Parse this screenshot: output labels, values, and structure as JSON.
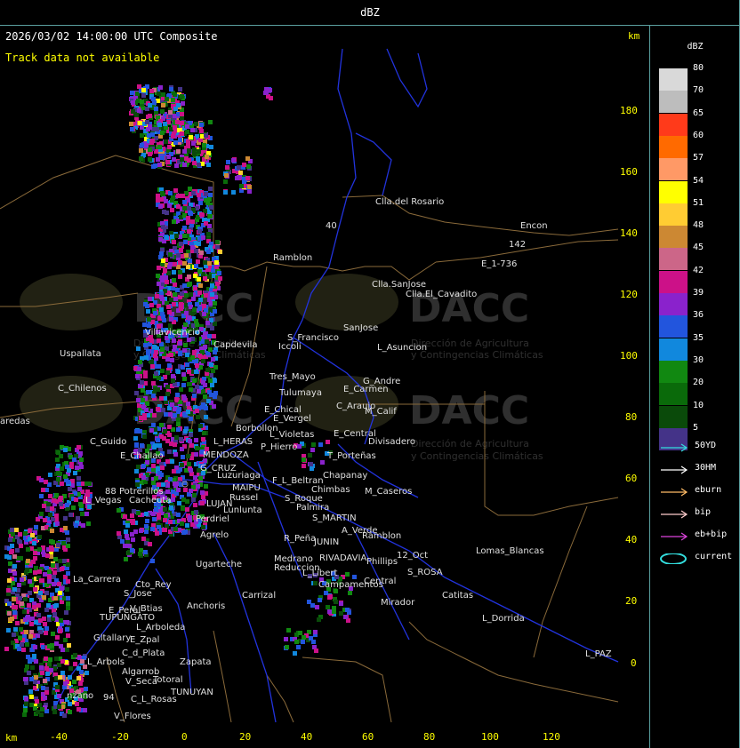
{
  "title": "dBZ",
  "timestamp": "2026/03/02 14:00:00 UTC Composite",
  "track_status": "Track data not available",
  "axis_unit": "km",
  "x_ticks": [
    "-40",
    "-20",
    "0",
    "20",
    "40",
    "60",
    "80",
    "100",
    "120"
  ],
  "y_ticks": [
    "180",
    "160",
    "140",
    "120",
    "100",
    "80",
    "60",
    "40",
    "20",
    "0"
  ],
  "watermark": {
    "brand": "DACC",
    "line1": "Dirección de Agricultura",
    "line2": "y Contingencias Climáticas"
  },
  "legend": {
    "title": "dBZ",
    "levels": [
      {
        "value": "80",
        "color": "#d9d9d9"
      },
      {
        "value": "70",
        "color": "#bdbdbd"
      },
      {
        "value": "65",
        "color": "#ff3a1a"
      },
      {
        "value": "60",
        "color": "#ff6a00"
      },
      {
        "value": "57",
        "color": "#ff9966"
      },
      {
        "value": "54",
        "color": "#ffff00"
      },
      {
        "value": "51",
        "color": "#ffcc33"
      },
      {
        "value": "48",
        "color": "#cc8833"
      },
      {
        "value": "45",
        "color": "#cc6688"
      },
      {
        "value": "42",
        "color": "#cc1188"
      },
      {
        "value": "39",
        "color": "#8a22cc"
      },
      {
        "value": "36",
        "color": "#2255dd"
      },
      {
        "value": "35",
        "color": "#1188dd"
      },
      {
        "value": "30",
        "color": "#118811"
      },
      {
        "value": "20",
        "color": "#0a6a0a"
      },
      {
        "value": "10",
        "color": "#0a4a0a"
      },
      {
        "value": "5",
        "color": "#443388"
      }
    ],
    "tracks": [
      {
        "label": "50YD",
        "color": "#33dddd"
      },
      {
        "label": "30HM",
        "color": "#ffffff"
      },
      {
        "label": "eburn",
        "color": "#ffbb66"
      },
      {
        "label": "bip",
        "color": "#ffcccc"
      },
      {
        "label": "eb+bip",
        "color": "#dd44dd"
      },
      {
        "label": "current",
        "color": "#33dddd"
      }
    ]
  },
  "places": [
    {
      "name": "Clla.del Rosario"
    },
    {
      "name": "Encon"
    },
    {
      "name": "142"
    },
    {
      "name": "E_1-736"
    },
    {
      "name": "Ramblon"
    },
    {
      "name": "40"
    },
    {
      "name": "Clla.SanJose"
    },
    {
      "name": "Clla.El_Cavadito"
    },
    {
      "name": "Villavicencio"
    },
    {
      "name": "Capdevila"
    },
    {
      "name": "S_Francisco"
    },
    {
      "name": "SanJose"
    },
    {
      "name": "Iccoli"
    },
    {
      "name": "L_Asuncion"
    },
    {
      "name": "Uspallata"
    },
    {
      "name": "Tres_Mayo"
    },
    {
      "name": "G_Andre"
    },
    {
      "name": "E_Carmen"
    },
    {
      "name": "C_Chilenos"
    },
    {
      "name": "Tulumaya"
    },
    {
      "name": "C_Araujo"
    },
    {
      "name": "E_Chical"
    },
    {
      "name": "M_Calif"
    },
    {
      "name": "E_Vergel"
    },
    {
      "name": "aredas"
    },
    {
      "name": "Borbollon"
    },
    {
      "name": "L_Violetas"
    },
    {
      "name": "E_Central"
    },
    {
      "name": "Divisadero"
    },
    {
      "name": "C_Guido"
    },
    {
      "name": "L_HERAS"
    },
    {
      "name": "P_Hierro"
    },
    {
      "name": "E_Challao"
    },
    {
      "name": "MENDOZA"
    },
    {
      "name": "T_Porteñas"
    },
    {
      "name": "G_CRUZ"
    },
    {
      "name": "Luzuriaga"
    },
    {
      "name": "F_L_Beltran"
    },
    {
      "name": "Chapanay"
    },
    {
      "name": "88"
    },
    {
      "name": "Potrerillos"
    },
    {
      "name": "MAIPU"
    },
    {
      "name": "Chimbas"
    },
    {
      "name": "M_Caseros"
    },
    {
      "name": "L_Vegas"
    },
    {
      "name": "Cacheuta"
    },
    {
      "name": "Russel"
    },
    {
      "name": "S_Roque"
    },
    {
      "name": "LUJAN"
    },
    {
      "name": "Palmira"
    },
    {
      "name": "Lunlunta"
    },
    {
      "name": "S_MARTIN"
    },
    {
      "name": "Perdriel"
    },
    {
      "name": "A_Verde"
    },
    {
      "name": "Agrelo"
    },
    {
      "name": "Ramblon"
    },
    {
      "name": "R_Peña"
    },
    {
      "name": "JUNIN"
    },
    {
      "name": "Lomas_Blancas"
    },
    {
      "name": "Ugarteche"
    },
    {
      "name": "Medrano"
    },
    {
      "name": "RIVADAVIA"
    },
    {
      "name": "12_Oct"
    },
    {
      "name": "Reduccion"
    },
    {
      "name": "Phillips"
    },
    {
      "name": "S_ROSA"
    },
    {
      "name": "La_Carrera"
    },
    {
      "name": "Cto_Rey"
    },
    {
      "name": "L_Libert"
    },
    {
      "name": "Central"
    },
    {
      "name": "S_Jose"
    },
    {
      "name": "Carrizal"
    },
    {
      "name": "Campamentos"
    },
    {
      "name": "Catitas"
    },
    {
      "name": "V_Btias"
    },
    {
      "name": "Anchoris"
    },
    {
      "name": "E_Peral"
    },
    {
      "name": "Mirador"
    },
    {
      "name": "TUPUNGATO"
    },
    {
      "name": "L_Dorrida"
    },
    {
      "name": "L_Arboleda"
    },
    {
      "name": "Gltallary"
    },
    {
      "name": "E_Zpal"
    },
    {
      "name": "C_d_Plata"
    },
    {
      "name": "L_PAZ"
    },
    {
      "name": "L_Arbols"
    },
    {
      "name": "Zapata"
    },
    {
      "name": "Algarrob"
    },
    {
      "name": "Totoral"
    },
    {
      "name": "V_Seca"
    },
    {
      "name": "TUNUYAN"
    },
    {
      "name": "nzano"
    },
    {
      "name": "94"
    },
    {
      "name": "C_L_Rosas"
    },
    {
      "name": "V_Flores"
    }
  ]
}
